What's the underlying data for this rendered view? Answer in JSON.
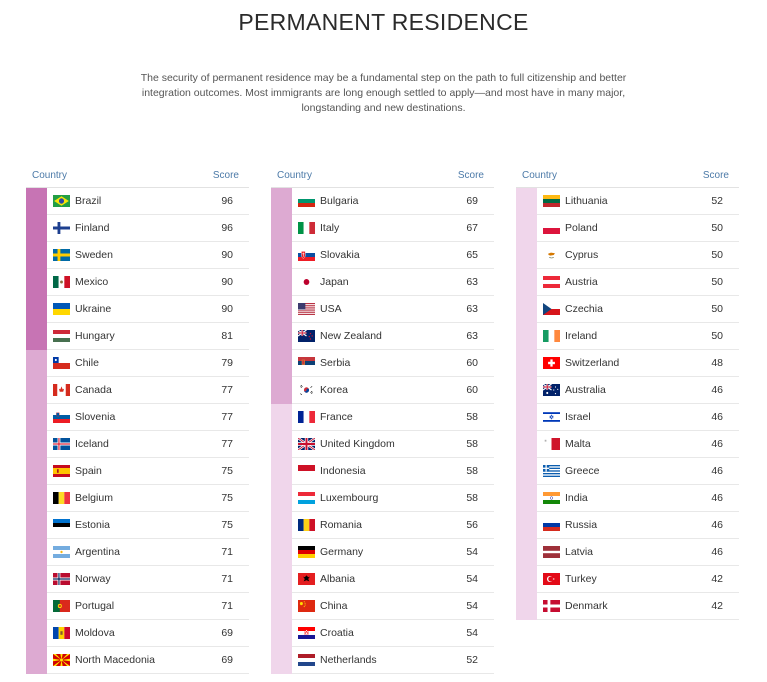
{
  "title": "PERMANENT RESIDENCE",
  "description": "The security of permanent residence may be a fundamental step on the path to full citizenship and better integration outcomes. Most immigrants are long enough settled to apply—and most have in many major, longstanding and new destinations.",
  "headers": {
    "country": "Country",
    "score": "Score"
  },
  "colors": {
    "tier1": "#c774b4",
    "tier2": "#ddaad2",
    "tier3": "#f0d6eb",
    "header_text": "#4c7aa8"
  },
  "columns": [
    [
      {
        "country": "Brazil",
        "score": 96,
        "flag": "brazil-flag-icon"
      },
      {
        "country": "Finland",
        "score": 96,
        "flag": "finland-flag-icon"
      },
      {
        "country": "Sweden",
        "score": 90,
        "flag": "sweden-flag-icon"
      },
      {
        "country": "Mexico",
        "score": 90,
        "flag": "mexico-flag-icon"
      },
      {
        "country": "Ukraine",
        "score": 90,
        "flag": "ukraine-flag-icon"
      },
      {
        "country": "Hungary",
        "score": 81,
        "flag": "hungary-flag-icon"
      },
      {
        "country": "Chile",
        "score": 79,
        "flag": "chile-flag-icon"
      },
      {
        "country": "Canada",
        "score": 77,
        "flag": "canada-flag-icon"
      },
      {
        "country": "Slovenia",
        "score": 77,
        "flag": "slovenia-flag-icon"
      },
      {
        "country": "Iceland",
        "score": 77,
        "flag": "iceland-flag-icon"
      },
      {
        "country": "Spain",
        "score": 75,
        "flag": "spain-flag-icon"
      },
      {
        "country": "Belgium",
        "score": 75,
        "flag": "belgium-flag-icon"
      },
      {
        "country": "Estonia",
        "score": 75,
        "flag": "estonia-flag-icon"
      },
      {
        "country": "Argentina",
        "score": 71,
        "flag": "argentina-flag-icon"
      },
      {
        "country": "Norway",
        "score": 71,
        "flag": "norway-flag-icon"
      },
      {
        "country": "Portugal",
        "score": 71,
        "flag": "portugal-flag-icon"
      },
      {
        "country": "Moldova",
        "score": 69,
        "flag": "moldova-flag-icon"
      },
      {
        "country": "North Macedonia",
        "score": 69,
        "flag": "north-macedonia-flag-icon"
      }
    ],
    [
      {
        "country": "Bulgaria",
        "score": 69,
        "flag": "bulgaria-flag-icon"
      },
      {
        "country": "Italy",
        "score": 67,
        "flag": "italy-flag-icon"
      },
      {
        "country": "Slovakia",
        "score": 65,
        "flag": "slovakia-flag-icon"
      },
      {
        "country": "Japan",
        "score": 63,
        "flag": "japan-flag-icon"
      },
      {
        "country": "USA",
        "score": 63,
        "flag": "usa-flag-icon"
      },
      {
        "country": "New Zealand",
        "score": 63,
        "flag": "new-zealand-flag-icon"
      },
      {
        "country": "Serbia",
        "score": 60,
        "flag": "serbia-flag-icon"
      },
      {
        "country": "Korea",
        "score": 60,
        "flag": "korea-flag-icon"
      },
      {
        "country": "France",
        "score": 58,
        "flag": "france-flag-icon"
      },
      {
        "country": "United Kingdom",
        "score": 58,
        "flag": "united-kingdom-flag-icon"
      },
      {
        "country": "Indonesia",
        "score": 58,
        "flag": "indonesia-flag-icon"
      },
      {
        "country": "Luxembourg",
        "score": 58,
        "flag": "luxembourg-flag-icon"
      },
      {
        "country": "Romania",
        "score": 56,
        "flag": "romania-flag-icon"
      },
      {
        "country": "Germany",
        "score": 54,
        "flag": "germany-flag-icon"
      },
      {
        "country": "Albania",
        "score": 54,
        "flag": "albania-flag-icon"
      },
      {
        "country": "China",
        "score": 54,
        "flag": "china-flag-icon"
      },
      {
        "country": "Croatia",
        "score": 54,
        "flag": "croatia-flag-icon"
      },
      {
        "country": "Netherlands",
        "score": 52,
        "flag": "netherlands-flag-icon"
      }
    ],
    [
      {
        "country": "Lithuania",
        "score": 52,
        "flag": "lithuania-flag-icon"
      },
      {
        "country": "Poland",
        "score": 50,
        "flag": "poland-flag-icon"
      },
      {
        "country": "Cyprus",
        "score": 50,
        "flag": "cyprus-flag-icon"
      },
      {
        "country": "Austria",
        "score": 50,
        "flag": "austria-flag-icon"
      },
      {
        "country": "Czechia",
        "score": 50,
        "flag": "czechia-flag-icon"
      },
      {
        "country": "Ireland",
        "score": 50,
        "flag": "ireland-flag-icon"
      },
      {
        "country": "Switzerland",
        "score": 48,
        "flag": "switzerland-flag-icon"
      },
      {
        "country": "Australia",
        "score": 46,
        "flag": "australia-flag-icon"
      },
      {
        "country": "Israel",
        "score": 46,
        "flag": "israel-flag-icon"
      },
      {
        "country": "Malta",
        "score": 46,
        "flag": "malta-flag-icon"
      },
      {
        "country": "Greece",
        "score": 46,
        "flag": "greece-flag-icon"
      },
      {
        "country": "India",
        "score": 46,
        "flag": "india-flag-icon"
      },
      {
        "country": "Russia",
        "score": 46,
        "flag": "russia-flag-icon"
      },
      {
        "country": "Latvia",
        "score": 46,
        "flag": "latvia-flag-icon"
      },
      {
        "country": "Turkey",
        "score": 42,
        "flag": "turkey-flag-icon"
      },
      {
        "country": "Denmark",
        "score": 42,
        "flag": "denmark-flag-icon"
      }
    ]
  ]
}
